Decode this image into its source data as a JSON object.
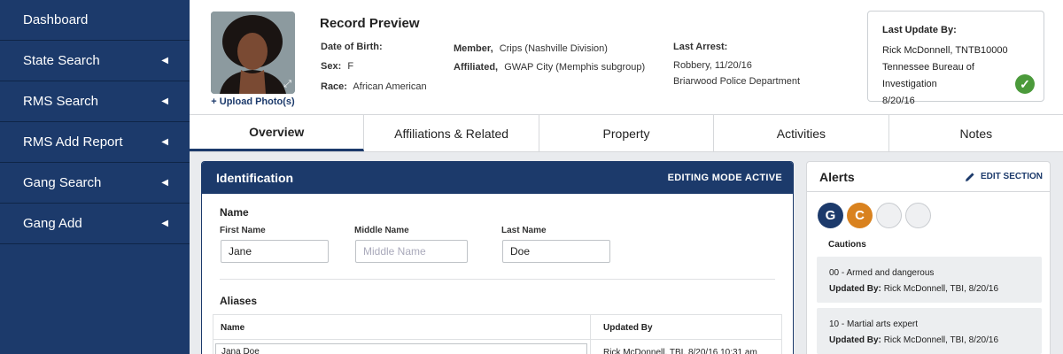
{
  "sidebar": {
    "items": [
      {
        "label": "Dashboard",
        "arrow": ""
      },
      {
        "label": "State Search",
        "arrow": "◀"
      },
      {
        "label": "RMS Search",
        "arrow": "◀"
      },
      {
        "label": "RMS Add Report",
        "arrow": "◀"
      },
      {
        "label": "Gang Search",
        "arrow": "◀"
      },
      {
        "label": "Gang Add",
        "arrow": "◀"
      }
    ]
  },
  "record": {
    "title": "Record Preview",
    "upload_label": "+ Upload Photo(s)",
    "dob_label": "Date of Birth:",
    "dob_value": "",
    "sex_label": "Sex:",
    "sex_value": "F",
    "race_label": "Race:",
    "race_value": "African American",
    "member_label": "Member,",
    "member_value": "Crips (Nashville Division)",
    "affiliated_label": "Affiliated,",
    "affiliated_value": "GWAP City (Memphis subgroup)",
    "last_arrest_label": "Last Arrest:",
    "last_arrest_value": "Robbery, 11/20/16",
    "last_arrest_dept": "Briarwood Police Department"
  },
  "last_update": {
    "title": "Last Update By:",
    "name": "Rick McDonnell, TNTB10000",
    "org": "Tennessee Bureau of Investigation",
    "date": "8/20/16",
    "status_color": "#4b9a3b"
  },
  "tabs": [
    {
      "label": "Overview",
      "active": true
    },
    {
      "label": "Affiliations & Related",
      "active": false
    },
    {
      "label": "Property",
      "active": false
    },
    {
      "label": "Activities",
      "active": false
    },
    {
      "label": "Notes",
      "active": false
    }
  ],
  "identification": {
    "title": "Identification",
    "mode": "EDITING MODE ACTIVE",
    "name_section": "Name",
    "first_label": "First Name",
    "first_value": "Jane",
    "middle_label": "Middle Name",
    "middle_placeholder": "Middle Name",
    "last_label": "Last Name",
    "last_value": "Doe",
    "aliases_section": "Aliases",
    "alias_col_name": "Name",
    "alias_col_updated": "Updated By",
    "aliases": [
      {
        "name": "Jana Doe",
        "updated_by": "Rick McDonnell, TBI, 8/20/16 10:31 am"
      }
    ]
  },
  "alerts": {
    "title": "Alerts",
    "edit_label": "EDIT SECTION",
    "badges": [
      {
        "letter": "G",
        "color": "#1c3a6b"
      },
      {
        "letter": "C",
        "color": "#d9821f"
      },
      {
        "letter": "",
        "color": ""
      },
      {
        "letter": "",
        "color": ""
      }
    ],
    "cautions_label": "Cautions",
    "cautions": [
      {
        "text": "00 - Armed and dangerous",
        "updated_label": "Updated By:",
        "updated_value": "Rick McDonnell, TBI, 8/20/16"
      },
      {
        "text": "10 - Martial arts expert",
        "updated_label": "Updated By:",
        "updated_value": "Rick McDonnell, TBI, 8/20/16"
      }
    ]
  }
}
